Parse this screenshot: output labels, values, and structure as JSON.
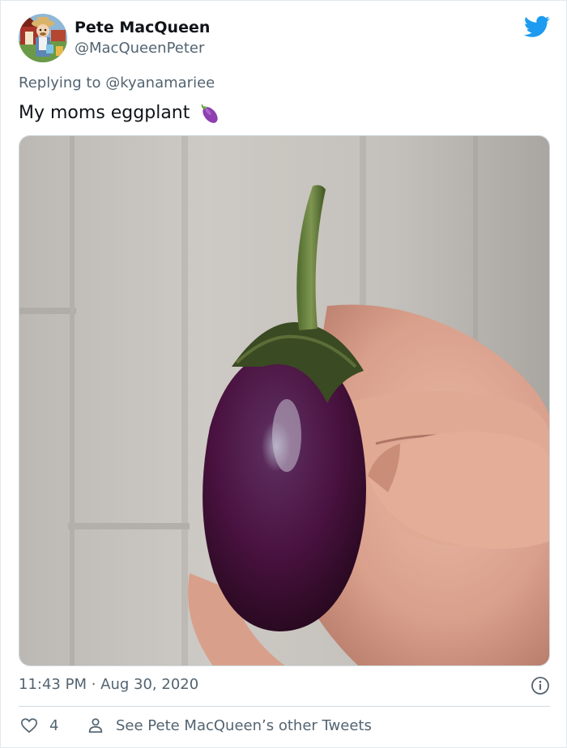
{
  "author": {
    "name": "Pete MacQueen",
    "handle": "@MacQueenPeter",
    "avatar_icon": "cartoon-avatar-icon"
  },
  "reply": {
    "prefix": "Replying to ",
    "mention": "@kyanamariee"
  },
  "tweet": {
    "text": "My moms eggplant",
    "emoji": "eggplant-emoji"
  },
  "media": {
    "alt_icon": "eggplant-photo"
  },
  "meta": {
    "timestamp": "11:43 PM · Aug 30, 2020"
  },
  "actions": {
    "like_count": "4",
    "other_tweets_label": "See Pete MacQueen’s other Tweets"
  },
  "colors": {
    "twitter_blue": "#1d9bf0",
    "secondary_text": "#536471",
    "primary_text": "#0f1419",
    "border": "#cfd9de"
  }
}
